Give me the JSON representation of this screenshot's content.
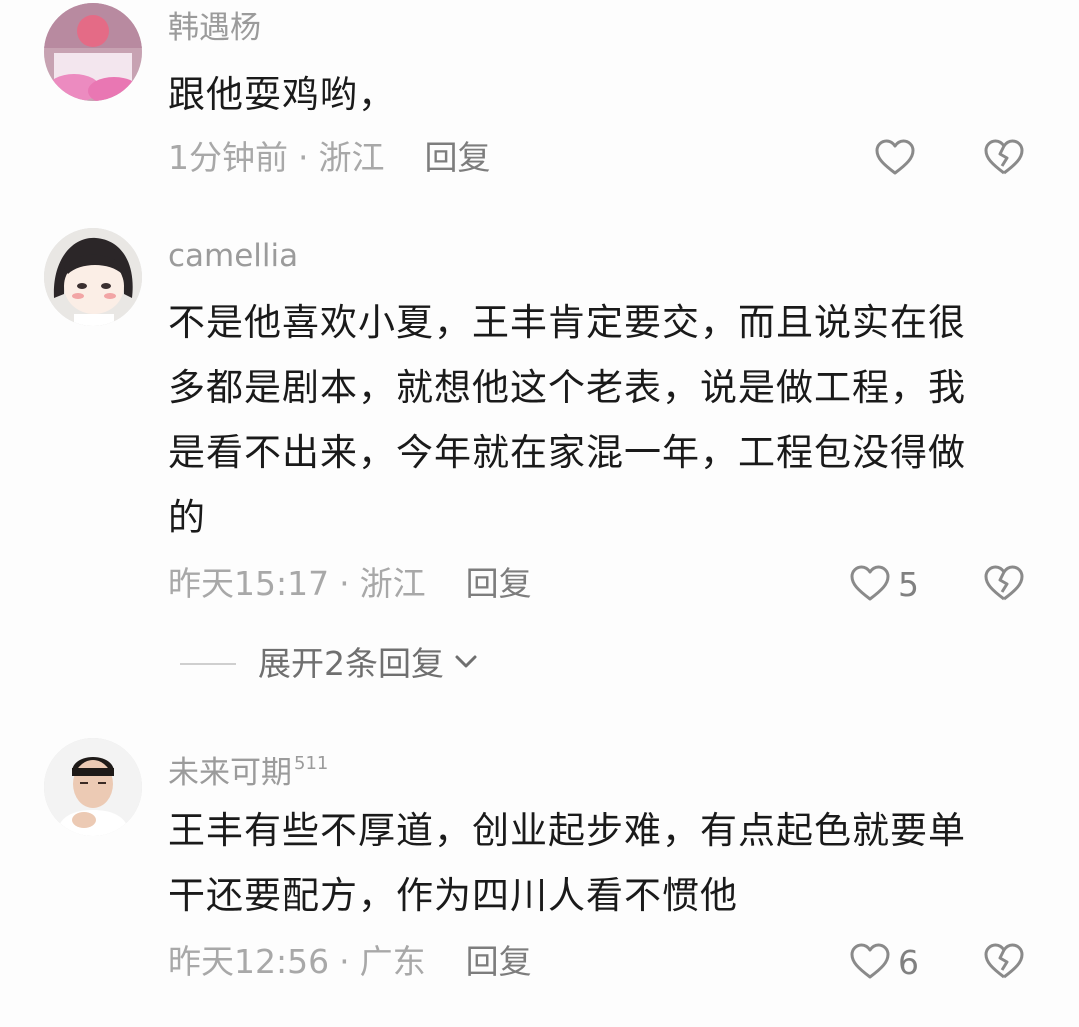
{
  "comments": [
    {
      "username": "韩遇杨",
      "badge": "",
      "content": "跟他耍鸡哟，",
      "time": "1分钟前",
      "location": "浙江",
      "reply_label": "回复",
      "likes": ""
    },
    {
      "username": "camellia",
      "badge": "",
      "content_lines": [
        "不是他喜欢小夏，王丰肯定要交，而且说实在很",
        "多都是剧本，就想他这个老表，说是做工程，我",
        "是看不出来，今年就在家混一年，工程包没得做",
        "的"
      ],
      "time": "昨天15:17",
      "location": "浙江",
      "reply_label": "回复",
      "likes": "5"
    },
    {
      "username": "未来可期",
      "badge": "511",
      "content_lines": [
        "王丰有些不厚道，创业起步难，有点起色就要单",
        "干还要配方，作为四川人看不惯他"
      ],
      "time": "昨天12:56",
      "location": "广东",
      "reply_label": "回复",
      "likes": "6"
    }
  ],
  "expand_replies": {
    "label": "展开2条回复"
  },
  "icons": {
    "like": "heart-outline-icon",
    "dislike": "broken-heart-icon",
    "expand": "chevron-down-icon"
  },
  "colors": {
    "text": "#1a1a1a",
    "secondary": "#a8a8a8",
    "icon": "#8a8a8a"
  }
}
